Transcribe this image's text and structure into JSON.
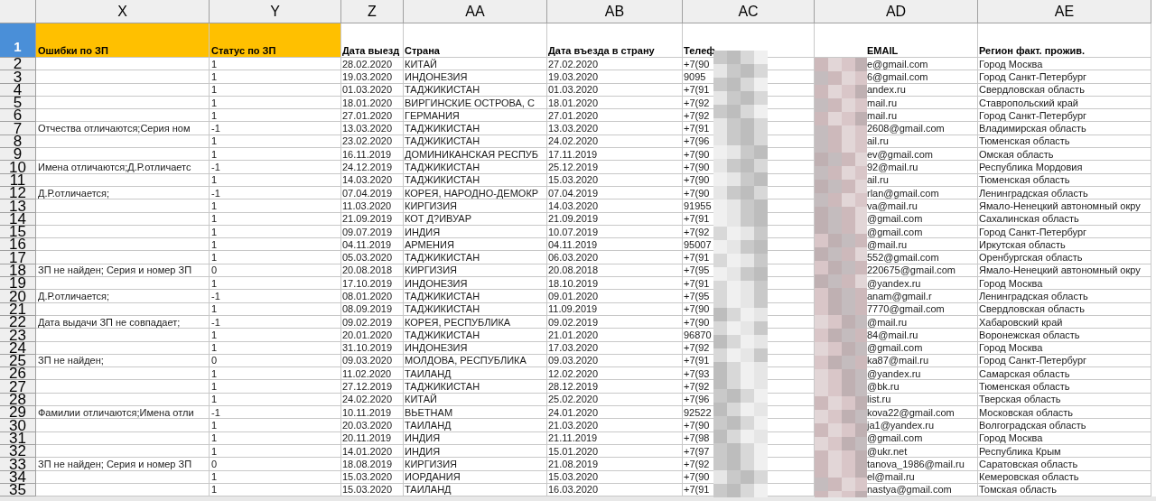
{
  "columns": [
    "X",
    "Y",
    "Z",
    "AA",
    "AB",
    "AC",
    "AD",
    "AE"
  ],
  "header_row": {
    "row": "1",
    "selected": true,
    "errors": "Ошибки по ЗП",
    "status": "Статус по ЗП",
    "departure": "Дата выезд",
    "country": "Страна",
    "entry": "Дата въезда в страну",
    "phone": "Телеф",
    "email": "EMAIL",
    "region": "Регион факт. прожив."
  },
  "rows": [
    {
      "row": "2",
      "selected": false,
      "status": "1",
      "departure": "28.02.2020",
      "country": "КИТАЙ",
      "entry": "27.02.2020",
      "phone": "+7(90",
      "email": "e@gmail.com",
      "region": "Город Москва"
    },
    {
      "row": "3",
      "selected": false,
      "status": "1",
      "departure": "19.03.2020",
      "country": "ИНДОНЕЗИЯ",
      "entry": "19.03.2020",
      "phone": "9095",
      "email": "6@gmail.com",
      "region": "Город Санкт-Петербург"
    },
    {
      "row": "4",
      "selected": false,
      "status": "1",
      "departure": "01.03.2020",
      "country": "ТАДЖИКИСТАН",
      "entry": "01.03.2020",
      "phone": "+7(91",
      "email": "andex.ru",
      "region": "Свердловская область"
    },
    {
      "row": "5",
      "selected": false,
      "status": "1",
      "departure": "18.01.2020",
      "country": "ВИРГИНСКИЕ ОСТРОВА, С",
      "entry": "18.01.2020",
      "phone": "+7(92",
      "email": "mail.ru",
      "region": "Ставропольский край"
    },
    {
      "row": "6",
      "selected": false,
      "status": "1",
      "departure": "27.01.2020",
      "country": "ГЕРМАНИЯ",
      "entry": "27.01.2020",
      "phone": "+7(92",
      "email": "mail.ru",
      "region": "Город Санкт-Петербург"
    },
    {
      "row": "7",
      "selected": false,
      "errors": "Отчества отличаются;Серия ном",
      "status": "-1",
      "departure": "13.03.2020",
      "country": "ТАДЖИКИСТАН",
      "entry": "13.03.2020",
      "phone": "+7(91",
      "email": "2608@gmail.com",
      "region": "Владимирская область"
    },
    {
      "row": "8",
      "selected": false,
      "status": "1",
      "departure": "23.02.2020",
      "country": "ТАДЖИКИСТАН",
      "entry": "24.02.2020",
      "phone": "+7(96",
      "email": "ail.ru",
      "region": "Тюменская область"
    },
    {
      "row": "9",
      "selected": false,
      "status": "1",
      "departure": "16.11.2019",
      "country": "ДОМИНИКАНСКАЯ РЕСПУБ",
      "entry": "17.11.2019",
      "phone": "+7(90",
      "email": "ev@gmail.com",
      "region": "Омская область"
    },
    {
      "row": "10",
      "selected": false,
      "errors": "Имена отличаются;Д.Р.отличаетс",
      "status": "-1",
      "departure": "24.12.2019",
      "country": "ТАДЖИКИСТАН",
      "entry": "25.12.2019",
      "phone": "+7(90",
      "email": "92@mail.ru",
      "region": "Республика Мордовия"
    },
    {
      "row": "11",
      "selected": false,
      "status": "1",
      "departure": "14.03.2020",
      "country": "ТАДЖИКИСТАН",
      "entry": "15.03.2020",
      "phone": "+7(90",
      "email": "ail.ru",
      "region": "Тюменская область"
    },
    {
      "row": "12",
      "selected": false,
      "errors": "Д.Р.отличается;",
      "status": "-1",
      "departure": "07.04.2019",
      "country": "КОРЕЯ, НАРОДНО-ДЕМОКР",
      "entry": "07.04.2019",
      "phone": "+7(90",
      "email": "rlan@gmail.com",
      "region": "Ленинградская область"
    },
    {
      "row": "13",
      "selected": false,
      "status": "1",
      "departure": "11.03.2020",
      "country": "КИРГИЗИЯ",
      "entry": "14.03.2020",
      "phone": "91955",
      "email": "va@mail.ru",
      "region": "Ямало-Ненецкий автономный окру"
    },
    {
      "row": "14",
      "selected": false,
      "status": "1",
      "departure": "21.09.2019",
      "country": "КОТ Д?ИВУАР",
      "entry": "21.09.2019",
      "phone": "+7(91",
      "email": "@gmail.com",
      "region": "Сахалинская область"
    },
    {
      "row": "15",
      "selected": false,
      "status": "1",
      "departure": "09.07.2019",
      "country": "ИНДИЯ",
      "entry": "10.07.2019",
      "phone": "+7(92",
      "email": "@gmail.com",
      "region": "Город Санкт-Петербург"
    },
    {
      "row": "16",
      "selected": false,
      "status": "1",
      "departure": "04.11.2019",
      "country": "АРМЕНИЯ",
      "entry": "04.11.2019",
      "phone": "95007",
      "email": "@mail.ru",
      "region": "Иркутская область"
    },
    {
      "row": "17",
      "selected": false,
      "status": "1",
      "departure": "05.03.2020",
      "country": "ТАДЖИКИСТАН",
      "entry": "06.03.2020",
      "phone": "+7(91",
      "email": "552@gmail.com",
      "region": "Оренбургская область"
    },
    {
      "row": "18",
      "selected": false,
      "errors": "ЗП не найден; Серия и номер ЗП",
      "status": "0",
      "departure": "20.08.2018",
      "country": "КИРГИЗИЯ",
      "entry": "20.08.2018",
      "phone": "+7(95",
      "email": "220675@gmail.com",
      "region": "Ямало-Ненецкий автономный окру"
    },
    {
      "row": "19",
      "selected": false,
      "status": "1",
      "departure": "17.10.2019",
      "country": "ИНДОНЕЗИЯ",
      "entry": "18.10.2019",
      "phone": "+7(91",
      "email": "@yandex.ru",
      "region": "Город Москва"
    },
    {
      "row": "20",
      "selected": false,
      "errors": "Д.Р.отличается;",
      "status": "-1",
      "departure": "08.01.2020",
      "country": "ТАДЖИКИСТАН",
      "entry": "09.01.2020",
      "phone": "+7(95",
      "email": "anam@gmail.r",
      "region": "Ленинградская область"
    },
    {
      "row": "21",
      "selected": false,
      "status": "1",
      "departure": "08.09.2019",
      "country": "ТАДЖИКИСТАН",
      "entry": "11.09.2019",
      "phone": "+7(90",
      "email": "7770@gmail.com",
      "region": "Свердловская область"
    },
    {
      "row": "22",
      "selected": false,
      "errors": "Дата выдачи ЗП не совпадает;",
      "status": "-1",
      "departure": "09.02.2019",
      "country": "КОРЕЯ, РЕСПУБЛИКА",
      "entry": "09.02.2019",
      "phone": "+7(90",
      "email": "@mail.ru",
      "region": "Хабаровский край"
    },
    {
      "row": "23",
      "selected": false,
      "status": "1",
      "departure": "20.01.2020",
      "country": "ТАДЖИКИСТАН",
      "entry": "21.01.2020",
      "phone": "96870",
      "email": "84@mail.ru",
      "region": "Воронежская область"
    },
    {
      "row": "24",
      "selected": false,
      "status": "1",
      "departure": "31.10.2019",
      "country": "ИНДОНЕЗИЯ",
      "entry": "17.03.2020",
      "phone": "+7(92",
      "email": "@gmail.com",
      "region": "Город Москва"
    },
    {
      "row": "25",
      "selected": false,
      "errors": "ЗП не найден;",
      "status": "0",
      "departure": "09.03.2020",
      "country": "МОЛДОВА, РЕСПУБЛИКА",
      "entry": "09.03.2020",
      "phone": "+7(91",
      "email": "ka87@mail.ru",
      "region": "Город Санкт-Петербург"
    },
    {
      "row": "26",
      "selected": false,
      "status": "1",
      "departure": "11.02.2020",
      "country": "ТАИЛАНД",
      "entry": "12.02.2020",
      "phone": "+7(93",
      "email": "@yandex.ru",
      "region": "Самарская область"
    },
    {
      "row": "27",
      "selected": false,
      "status": "1",
      "departure": "27.12.2019",
      "country": "ТАДЖИКИСТАН",
      "entry": "28.12.2019",
      "phone": "+7(92",
      "email": "@bk.ru",
      "region": "Тюменская область"
    },
    {
      "row": "28",
      "selected": false,
      "status": "1",
      "departure": "24.02.2020",
      "country": "КИТАЙ",
      "entry": "25.02.2020",
      "phone": "+7(96",
      "email": "list.ru",
      "region": "Тверская область"
    },
    {
      "row": "29",
      "selected": false,
      "errors": "Фамилии отличаются;Имена отли",
      "status": "-1",
      "departure": "10.11.2019",
      "country": "ВЬЕТНАМ",
      "entry": "24.01.2020",
      "phone": "92522",
      "email": "kova22@gmail.com",
      "region": "Московская область"
    },
    {
      "row": "30",
      "selected": false,
      "status": "1",
      "departure": "20.03.2020",
      "country": "ТАИЛАНД",
      "entry": "21.03.2020",
      "phone": "+7(90",
      "email": "ja1@yandex.ru",
      "region": "Волгоградская область"
    },
    {
      "row": "31",
      "selected": false,
      "status": "1",
      "departure": "20.11.2019",
      "country": "ИНДИЯ",
      "entry": "21.11.2019",
      "phone": "+7(98",
      "email": "@gmail.com",
      "region": "Город Москва"
    },
    {
      "row": "32",
      "selected": false,
      "status": "1",
      "departure": "14.01.2020",
      "country": "ИНДИЯ",
      "entry": "15.01.2020",
      "phone": "+7(97",
      "email": "@ukr.net",
      "region": "Республика Крым"
    },
    {
      "row": "33",
      "selected": false,
      "errors": "ЗП не найден; Серия и номер ЗП",
      "status": "0",
      "departure": "18.08.2019",
      "country": "КИРГИЗИЯ",
      "entry": "21.08.2019",
      "phone": "+7(92",
      "email": "tanova_1986@mail.ru",
      "region": "Саратовская область"
    },
    {
      "row": "34",
      "selected": false,
      "status": "1",
      "departure": "15.03.2020",
      "country": "ИОРДАНИЯ",
      "entry": "15.03.2020",
      "phone": "+7(90",
      "email": "el@mail.ru",
      "region": "Кемеровская область"
    },
    {
      "row": "35",
      "selected": false,
      "status": "1",
      "departure": "15.03.2020",
      "country": "ТАИЛАНД",
      "entry": "16.03.2020",
      "phone": "+7(91",
      "email": "nastya@gmail.com",
      "region": "Томская область"
    }
  ]
}
